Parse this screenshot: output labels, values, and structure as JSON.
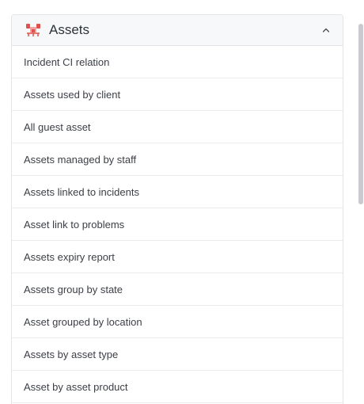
{
  "panel": {
    "title": "Assets",
    "icon": "assets-icon",
    "expanded": true,
    "accent_color": "#e0504d"
  },
  "items": [
    {
      "label": "Incident CI relation"
    },
    {
      "label": "Assets used by client"
    },
    {
      "label": "All guest asset"
    },
    {
      "label": "Assets managed by staff"
    },
    {
      "label": "Assets linked to incidents"
    },
    {
      "label": "Asset link to problems"
    },
    {
      "label": "Assets expiry report"
    },
    {
      "label": "Assets group by state"
    },
    {
      "label": "Asset grouped by location"
    },
    {
      "label": "Assets by asset type"
    },
    {
      "label": "Asset by asset product"
    }
  ]
}
